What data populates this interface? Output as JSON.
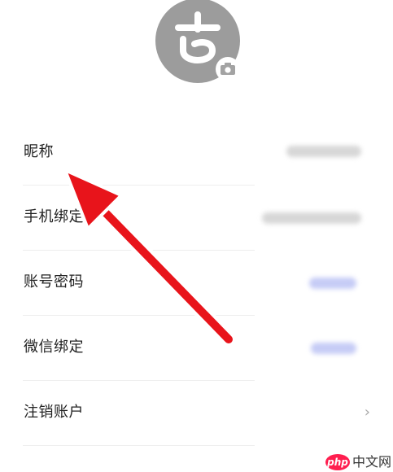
{
  "profile": {
    "avatar_icon": "user-avatar-logo-icon",
    "camera_icon": "camera-icon"
  },
  "settings": [
    {
      "label": "昵称"
    },
    {
      "label": "手机绑定"
    },
    {
      "label": "账号密码"
    },
    {
      "label": "微信绑定"
    },
    {
      "label": "注销账户",
      "chevron": "›"
    }
  ],
  "annotation": {
    "icon": "red-arrow-icon",
    "color": "#e8141b"
  },
  "watermark": {
    "logo_text": "php",
    "site_text": "中文网"
  },
  "colors": {
    "avatar": "#9c9c9c",
    "divider": "#eeeeee",
    "blurred_blue": "#c6ccf6"
  }
}
